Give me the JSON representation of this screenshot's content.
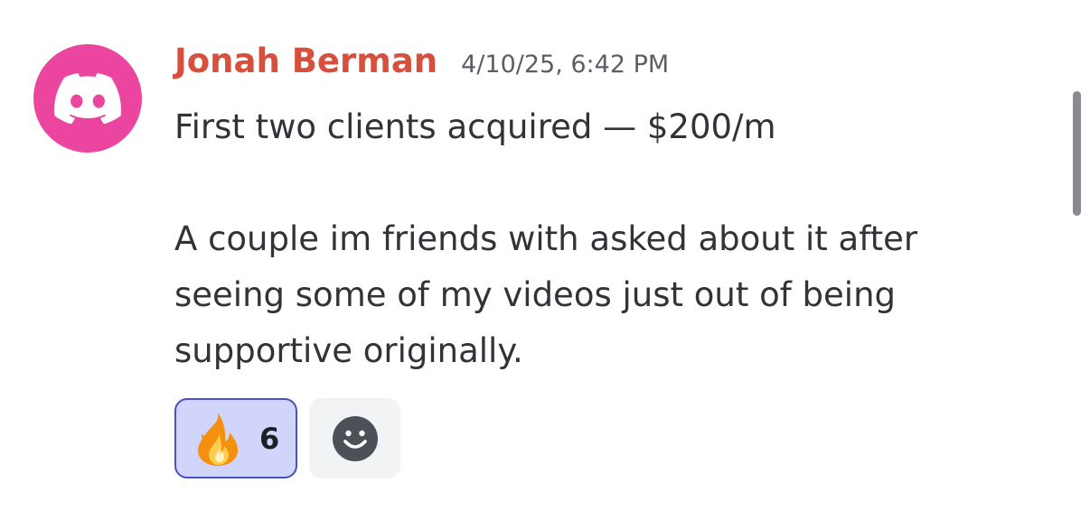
{
  "message": {
    "author": "Jonah Berman",
    "timestamp": "4/10/25, 6:42 PM",
    "avatar_icon": "discord-logo-icon",
    "lines": {
      "first": "First two clients acquired — $200/m",
      "second": "A couple im friends with asked about it after",
      "third": "seeing some of my videos just out of being",
      "fourth": "supportive originally."
    }
  },
  "reactions": [
    {
      "icon": "fire-emoji-icon",
      "count": "6",
      "selected": true
    }
  ],
  "add_reaction": {
    "icon": "add-reaction-smiley-icon"
  },
  "colors": {
    "avatar_bg": "#eb459f",
    "author": "#d7503d",
    "reaction_bg": "#d1d4fb",
    "reaction_border": "#4752c4"
  }
}
